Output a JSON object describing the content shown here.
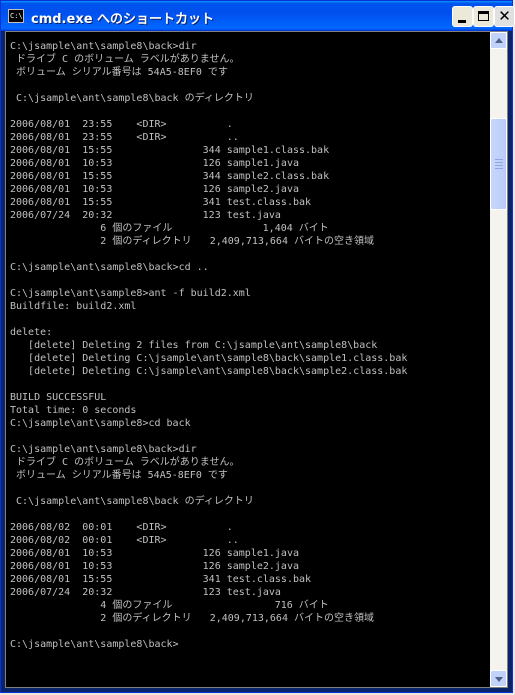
{
  "window": {
    "title": "cmd.exe へのショートカット",
    "icon_text": "C:\\"
  },
  "controls": {
    "minimize": "minimize-icon",
    "maximize": "maximize-icon",
    "close": "close-icon",
    "close_glyph": "✕"
  },
  "console": {
    "lines": [
      "C:\\jsample\\ant\\sample8\\back>dir",
      " ドライブ C のボリューム ラベルがありません。",
      " ボリューム シリアル番号は 54A5-8EF0 です",
      "",
      " C:\\jsample\\ant\\sample8\\back のディレクトリ",
      "",
      "2006/08/01  23:55    <DIR>          .",
      "2006/08/01  23:55    <DIR>          ..",
      "2006/08/01  15:55               344 sample1.class.bak",
      "2006/08/01  10:53               126 sample1.java",
      "2006/08/01  15:55               344 sample2.class.bak",
      "2006/08/01  10:53               126 sample2.java",
      "2006/08/01  15:55               341 test.class.bak",
      "2006/07/24  20:32               123 test.java",
      "               6 個のファイル               1,404 バイト",
      "               2 個のディレクトリ   2,409,713,664 バイトの空き領域",
      "",
      "C:\\jsample\\ant\\sample8\\back>cd ..",
      "",
      "C:\\jsample\\ant\\sample8>ant -f build2.xml",
      "Buildfile: build2.xml",
      "",
      "delete:",
      "   [delete] Deleting 2 files from C:\\jsample\\ant\\sample8\\back",
      "   [delete] Deleting C:\\jsample\\ant\\sample8\\back\\sample1.class.bak",
      "   [delete] Deleting C:\\jsample\\ant\\sample8\\back\\sample2.class.bak",
      "",
      "BUILD SUCCESSFUL",
      "Total time: 0 seconds",
      "C:\\jsample\\ant\\sample8>cd back",
      "",
      "C:\\jsample\\ant\\sample8\\back>dir",
      " ドライブ C のボリューム ラベルがありません。",
      " ボリューム シリアル番号は 54A5-8EF0 です",
      "",
      " C:\\jsample\\ant\\sample8\\back のディレクトリ",
      "",
      "2006/08/02  00:01    <DIR>          .",
      "2006/08/02  00:01    <DIR>          ..",
      "2006/08/01  10:53               126 sample1.java",
      "2006/08/01  10:53               126 sample2.java",
      "2006/08/01  15:55               341 test.class.bak",
      "2006/07/24  20:32               123 test.java",
      "               4 個のファイル                 716 バイト",
      "               2 個のディレクトリ   2,409,713,664 バイトの空き領域",
      "",
      "C:\\jsample\\ant\\sample8\\back>"
    ]
  },
  "scrollbar": {
    "up": "scroll-up-arrow-icon",
    "down": "scroll-down-arrow-icon"
  },
  "colors": {
    "console_bg": "#000000",
    "console_fg": "#c0c0c0",
    "title_blue": "#0054e3"
  }
}
